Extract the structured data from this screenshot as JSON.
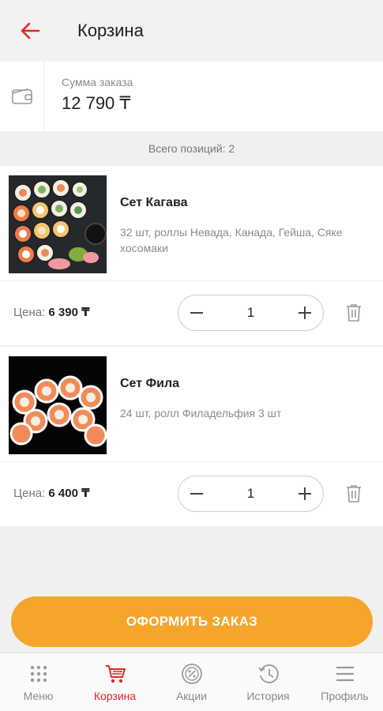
{
  "header": {
    "title": "Корзина"
  },
  "summary": {
    "label": "Сумма заказа",
    "value": "12 790 ₸"
  },
  "total_positions": "Всего позиций: 2",
  "items": [
    {
      "name": "Сет Кагава",
      "description": "32 шт, роллы Невада, Канада, Гейша, Сяке хосомаки",
      "price_label": "Цена:",
      "price": "6 390 ₸",
      "quantity": "1"
    },
    {
      "name": "Сет Фила",
      "description": "24 шт, ролл Филадельфия 3 шт",
      "price_label": "Цена:",
      "price": "6 400 ₸",
      "quantity": "1"
    }
  ],
  "checkout": {
    "label": "ОФОРМИТЬ ЗАКАЗ"
  },
  "nav": [
    {
      "label": "Меню",
      "icon": "menu-grid-icon",
      "active": false
    },
    {
      "label": "Корзина",
      "icon": "cart-icon",
      "active": true
    },
    {
      "label": "Акции",
      "icon": "discount-icon",
      "active": false
    },
    {
      "label": "История",
      "icon": "history-icon",
      "active": false
    },
    {
      "label": "Профиль",
      "icon": "hamburger-icon",
      "active": false
    }
  ],
  "colors": {
    "accent": "#e3262d",
    "checkout": "#f5a52a",
    "background": "#f0f0f0"
  }
}
